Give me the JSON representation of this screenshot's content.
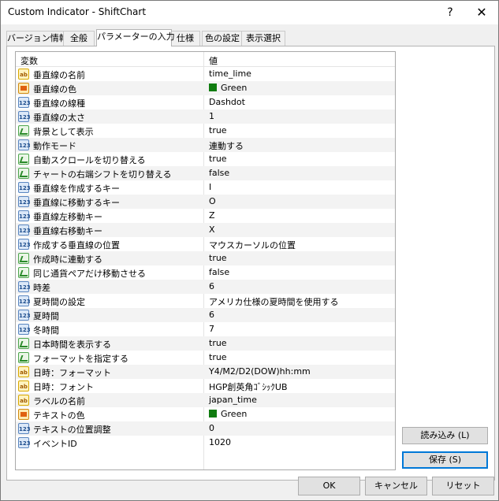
{
  "window": {
    "title": "Custom Indicator - ShiftChart",
    "help_glyph": "?",
    "close_glyph": "✕"
  },
  "tabs": [
    {
      "label": "バージョン情報",
      "active": false
    },
    {
      "label": "全般",
      "active": false
    },
    {
      "label": "パラメーターの入力",
      "active": true
    },
    {
      "label": "仕様",
      "active": false
    },
    {
      "label": "色の設定",
      "active": false
    },
    {
      "label": "表示選択",
      "active": false
    }
  ],
  "grid": {
    "header": {
      "variable": "変数",
      "value": "値"
    },
    "rows": [
      {
        "icon": "ab",
        "name": "垂直線の名前",
        "value": "time_lime"
      },
      {
        "icon": "color",
        "name": "垂直線の色",
        "value": "Green",
        "swatch": "#107c10"
      },
      {
        "icon": "num",
        "name": "垂直線の線種",
        "value": "Dashdot"
      },
      {
        "icon": "num",
        "name": "垂直線の太さ",
        "value": "1"
      },
      {
        "icon": "bool",
        "name": "背景として表示",
        "value": "true"
      },
      {
        "icon": "num",
        "name": "動作モード",
        "value": "連動する"
      },
      {
        "icon": "bool",
        "name": "自動スクロールを切り替える",
        "value": "true"
      },
      {
        "icon": "bool",
        "name": "チャートの右端シフトを切り替える",
        "value": "false"
      },
      {
        "icon": "num",
        "name": "垂直線を作成するキー",
        "value": "I"
      },
      {
        "icon": "num",
        "name": "垂直線に移動するキー",
        "value": "O"
      },
      {
        "icon": "num",
        "name": "垂直線左移動キー",
        "value": "Z"
      },
      {
        "icon": "num",
        "name": "垂直線右移動キー",
        "value": "X"
      },
      {
        "icon": "num",
        "name": "作成する垂直線の位置",
        "value": "マウスカーソルの位置"
      },
      {
        "icon": "bool",
        "name": "作成時に連動する",
        "value": "true"
      },
      {
        "icon": "bool",
        "name": "同じ通貨ペアだけ移動させる",
        "value": "false"
      },
      {
        "icon": "num",
        "name": "時差",
        "value": "6"
      },
      {
        "icon": "num",
        "name": "夏時間の設定",
        "value": "アメリカ仕様の夏時間を使用する"
      },
      {
        "icon": "num",
        "name": "夏時間",
        "value": "6"
      },
      {
        "icon": "num",
        "name": "冬時間",
        "value": "7"
      },
      {
        "icon": "bool",
        "name": "日本時間を表示する",
        "value": "true"
      },
      {
        "icon": "bool",
        "name": "フォーマットを指定する",
        "value": "true"
      },
      {
        "icon": "ab",
        "name": "日時：フォーマット",
        "value": "Y4/M2/D2(DOW)hh:mm"
      },
      {
        "icon": "ab",
        "name": "日時：フォント",
        "value": "HGP創英角ｺﾞｼｯｸUB"
      },
      {
        "icon": "ab",
        "name": "ラベルの名前",
        "value": "japan_time"
      },
      {
        "icon": "color",
        "name": "テキストの色",
        "value": "Green",
        "swatch": "#107c10"
      },
      {
        "icon": "num",
        "name": "テキストの位置調整",
        "value": "0"
      },
      {
        "icon": "num",
        "name": "イベントID",
        "value": "1020"
      }
    ]
  },
  "icon_labels": {
    "ab": "ab",
    "num": "123",
    "bool": "",
    "color": ""
  },
  "side_buttons": {
    "load": "読み込み (L)",
    "save": "保存 (S)"
  },
  "bottom_buttons": {
    "ok": "OK",
    "cancel": "キャンセル",
    "reset": "リセット"
  }
}
